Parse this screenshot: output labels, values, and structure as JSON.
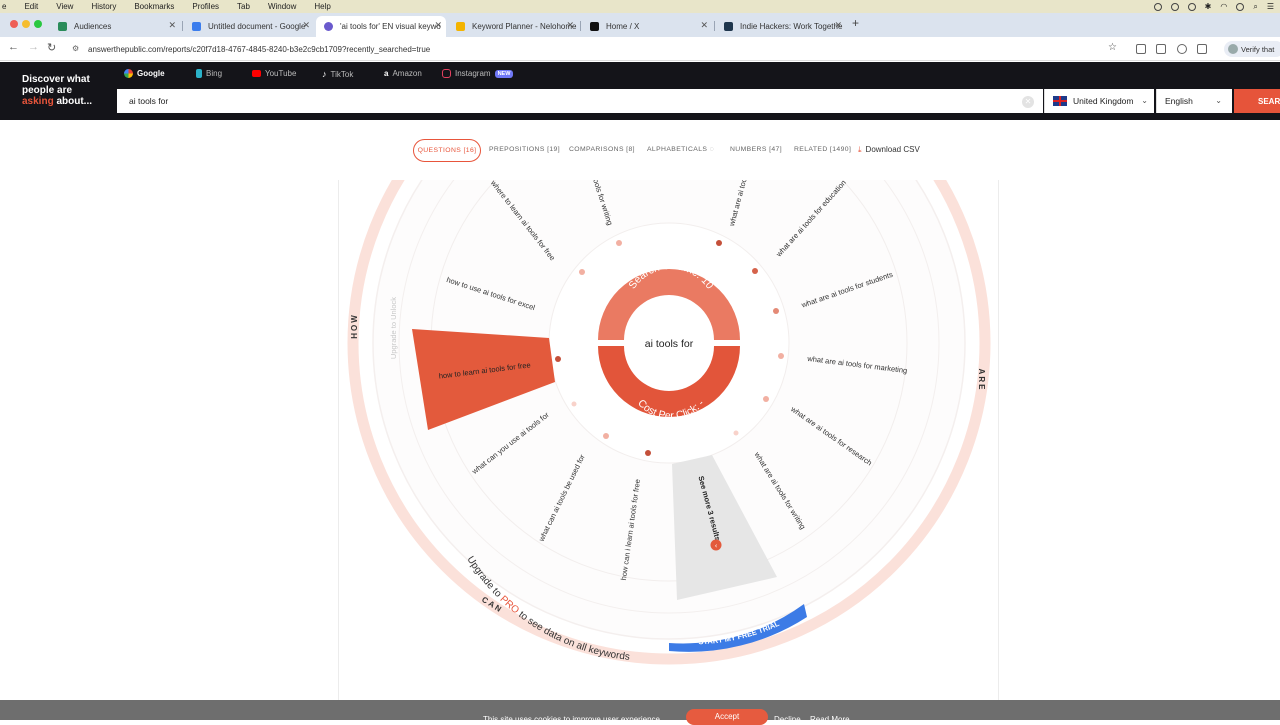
{
  "menubar": {
    "items": [
      "e",
      "Edit",
      "View",
      "History",
      "Bookmarks",
      "Profiles",
      "Tab",
      "Window",
      "Help"
    ]
  },
  "tabs": [
    {
      "title": "Audiences",
      "icon": "audiences-icon",
      "color": "#2a8c5a"
    },
    {
      "title": "Untitled document - Google",
      "icon": "google-docs-icon",
      "color": "#3b7ded"
    },
    {
      "title": "'ai tools for' EN visual keywo",
      "icon": "answerthepublic-icon",
      "color": "#6a5acd"
    },
    {
      "title": "Keyword Planner - Nelohome",
      "icon": "google-ads-icon",
      "color": "#f4b400"
    },
    {
      "title": "Home / X",
      "icon": "x-icon",
      "color": "#111111"
    },
    {
      "title": "Indie Hackers: Work Togethe",
      "icon": "indie-hackers-icon",
      "color": "#1f364d"
    }
  ],
  "browser": {
    "url": "answerthepublic.com/reports/c20f7d18-4767-4845-8240-b3e2c9cb1709?recently_searched=true",
    "profile_label": "Verify that",
    "new_tab": "+"
  },
  "site": {
    "logo_line1": "Discover what",
    "logo_line2": "people are",
    "logo_line3_hl": "asking",
    "logo_line3_rest": " about...",
    "platforms": [
      {
        "label": "Google",
        "icon": "google-icon",
        "active": true
      },
      {
        "label": "Bing",
        "icon": "bing-icon",
        "active": false
      },
      {
        "label": "YouTube",
        "icon": "youtube-icon",
        "active": false
      },
      {
        "label": "TikTok",
        "icon": "tiktok-icon",
        "active": false
      },
      {
        "label": "Amazon",
        "icon": "amazon-icon",
        "active": false
      },
      {
        "label": "Instagram",
        "icon": "instagram-icon",
        "active": false,
        "badge": "NEW"
      }
    ],
    "search_value": "ai tools for",
    "country": "United Kingdom",
    "language": "English",
    "search_button": "SEARCH",
    "accent_color": "#e8553b"
  },
  "report_tabs": [
    {
      "label": "QUESTIONS [16]",
      "active": true
    },
    {
      "label": "PREPOSITIONS [19]",
      "active": false
    },
    {
      "label": "COMPARISONS [8]",
      "active": false
    },
    {
      "label": "ALPHABETICALS",
      "active": false
    },
    {
      "label": "NUMBERS [47]",
      "active": false
    },
    {
      "label": "RELATED [1490]",
      "active": false
    }
  ],
  "download_csv": "Download CSV",
  "wheel": {
    "center": "ai tools for",
    "top_arc": "Search Volume: 10",
    "bottom_arc": "Cost Per Click: -",
    "section_how": "HOW",
    "section_are": "ARE",
    "section_can": "CAN",
    "upgrade_lock": "Upgrade to Unlock",
    "upgrade_prefix": "Upgrade to ",
    "upgrade_pro": "PRO",
    "upgrade_suffix": " to see data on all keywords",
    "trial_button": "START MY FREE TRIAL",
    "see_more": "See more 3 results",
    "questions": [
      "where to learn ai tools for free",
      "ai tools for writing",
      "what are ai tools",
      "what are ai tools for education",
      "how to use ai tools for excel",
      "what are ai tools for students",
      "how to learn ai tools for free",
      "what are ai tools for marketing",
      "what are ai tools for research",
      "what can you use ai tools for",
      "what are ai tools for writing",
      "what can ai tools be used for",
      "how can i learn ai tools for free"
    ]
  },
  "cookie": {
    "text": "This site uses cookies to improve user experience",
    "accept": "Accept",
    "decline": "Decline",
    "read_more": "Read More"
  }
}
